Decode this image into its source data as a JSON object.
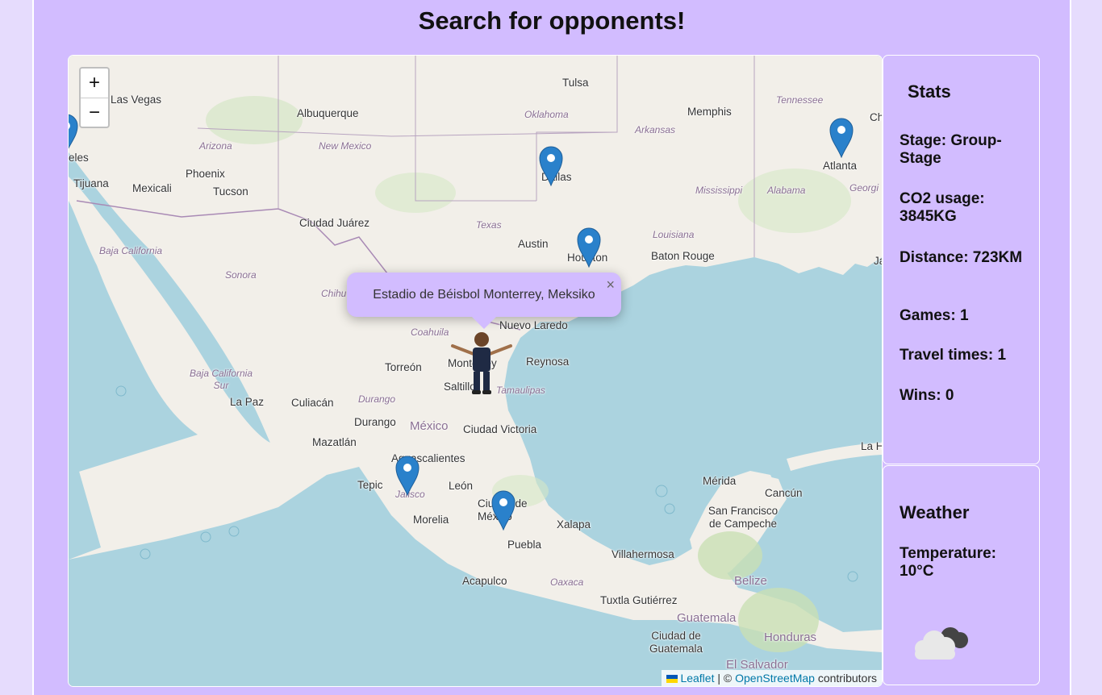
{
  "page": {
    "title": "Search for opponents!"
  },
  "map": {
    "zoom_in": "+",
    "zoom_out": "−",
    "places": {
      "las_vegas": "Las Vegas",
      "albuquerque": "Albuquerque",
      "tulsa": "Tulsa",
      "memphis": "Memphis",
      "phoenix": "Phoenix",
      "tucson": "Tucson",
      "tijuana": "Tijuana",
      "mexicali": "Mexicali",
      "angeles": "eles",
      "dallas": "Dallas",
      "atlanta": "Atlanta",
      "ciudad_juarez": "Ciudad Juárez",
      "austin": "Austin",
      "houston": "Houston",
      "baton_rouge": "Baton Rouge",
      "chihuahua": "Chihu",
      "nuevo_laredo": "Nuevo Laredo",
      "reynosa": "Reynosa",
      "torreon": "Torreón",
      "monterrey": "Monterrey",
      "saltillo": "Saltillo",
      "la_paz": "La Paz",
      "culiacan": "Culiacán",
      "durango": "Durango",
      "ciudad_victoria": "Ciudad Victoria",
      "mazatlan": "Mazatlán",
      "aguascalientes": "Aguascalientes",
      "tepic": "Tepic",
      "leon": "León",
      "morelia": "Morelia",
      "ciudad_de_mexico": "Ciudad de México",
      "xalapa": "Xalapa",
      "puebla": "Puebla",
      "acapulco": "Acapulco",
      "villahermosa": "Villahermosa",
      "merida": "Mérida",
      "cancun": "Cancún",
      "san_francisco_de_campeche": "San Francisco de Campeche",
      "tuxtla": "Tuxtla Gutiérrez",
      "belize": "Belize",
      "guatemala": "Guatemala",
      "ciudad_de_guatemala": "Ciudad de Guatemala",
      "honduras": "Honduras",
      "el_salvador": "El Salvador",
      "ja": "Ja",
      "ch": "Ch",
      "la_h": "La H"
    },
    "regions": {
      "oklahoma": "Oklahoma",
      "arkansas": "Arkansas",
      "tennessee": "Tennessee",
      "arizona": "Arizona",
      "new_mexico": "New Mexico",
      "mississippi": "Mississippi",
      "alabama": "Alabama",
      "georgia": "Georgi",
      "texas": "Texas",
      "louisiana": "Louisiana",
      "baja_california": "Baja California",
      "sonora": "Sonora",
      "coahuila": "Coahuila",
      "baja_california_sur": "Baja California Sur",
      "durango_state": "Durango",
      "tamaulipas": "Tamaulipas",
      "jalisco": "Jalisco",
      "oaxaca": "Oaxaca"
    },
    "country": "México",
    "popup": {
      "text": "Estadio de Béisbol Monterrey, Meksiko",
      "close": "×"
    },
    "attribution": {
      "leaflet": "Leaflet",
      "separator": " | © ",
      "osm": "OpenStreetMap",
      "contributors": " contributors"
    },
    "colors": {
      "marker": "#2a81cb",
      "water": "#abd3df",
      "land": "#f2efe9"
    }
  },
  "stats": {
    "heading": "Stats",
    "stage": "Stage: Group-Stage",
    "co2": "CO2 usage: 3845KG",
    "distance": "Distance: 723KM",
    "games": "Games: 1",
    "travel_times": "Travel times: 1",
    "wins": "Wins: 0"
  },
  "weather": {
    "heading": "Weather",
    "temperature": "Temperature: 10°C",
    "icon": "cloudy-icon"
  }
}
